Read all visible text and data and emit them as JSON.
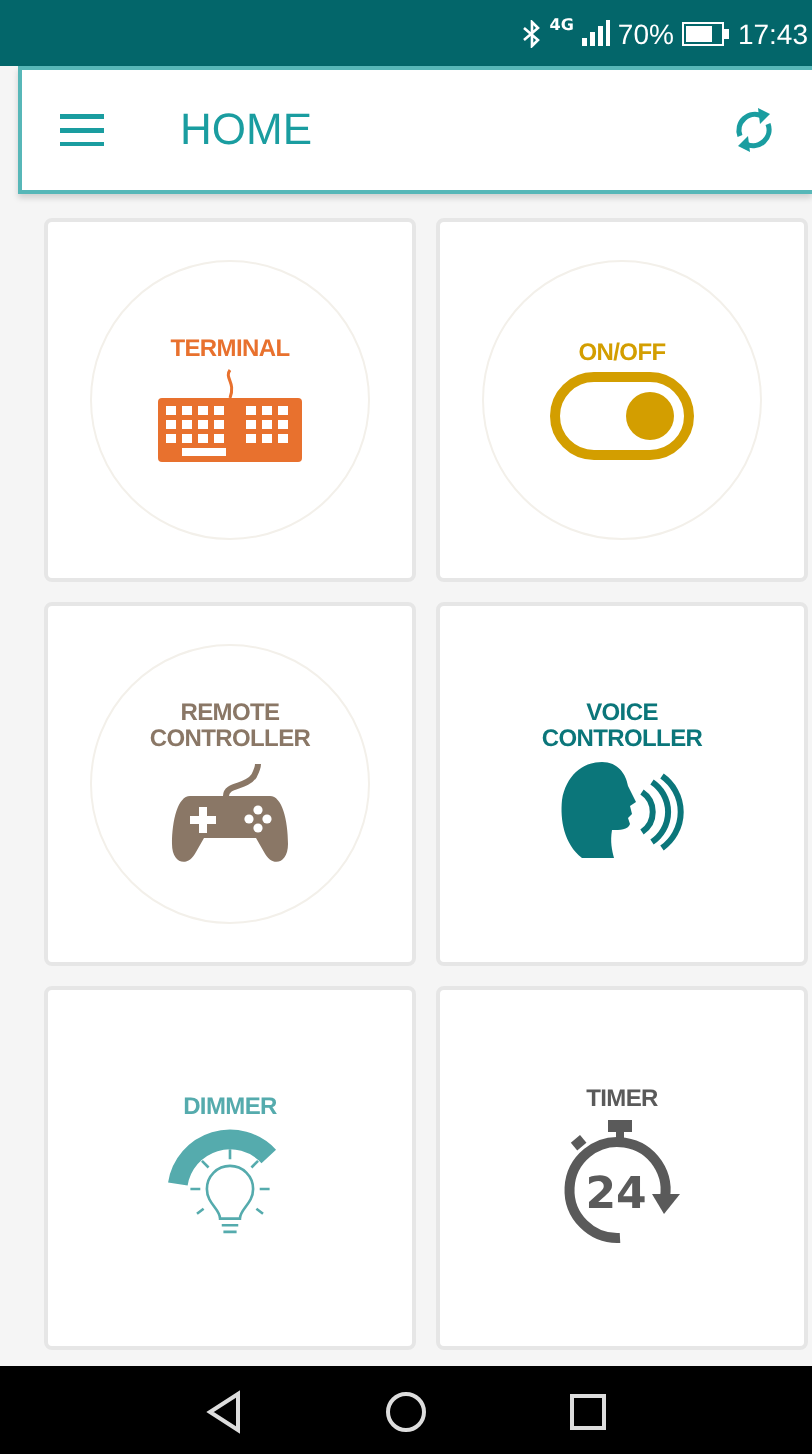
{
  "status_bar": {
    "network": "4G",
    "battery": "70%",
    "time": "17:43"
  },
  "app_bar": {
    "title": "HOME"
  },
  "tiles": [
    {
      "kind": "terminal",
      "label": "TERMINAL",
      "color": "#e8712e",
      "ring": true
    },
    {
      "kind": "switch",
      "label": "ON/OFF",
      "color": "#d39e00",
      "ring": true,
      "on": true
    },
    {
      "kind": "gamepad",
      "label": "REMOTE\nCONTROLLER",
      "color": "#8a7766",
      "ring": true
    },
    {
      "kind": "voice",
      "label": "VOICE\nCONTROLLER",
      "color": "#0b767a",
      "ring": false
    },
    {
      "kind": "dimmer",
      "label": "DIMMER",
      "color": "#55abad",
      "ring": false
    },
    {
      "kind": "timer",
      "label": "TIMER",
      "color": "#5a5a5a",
      "ring": false,
      "icon_text": "24"
    }
  ]
}
